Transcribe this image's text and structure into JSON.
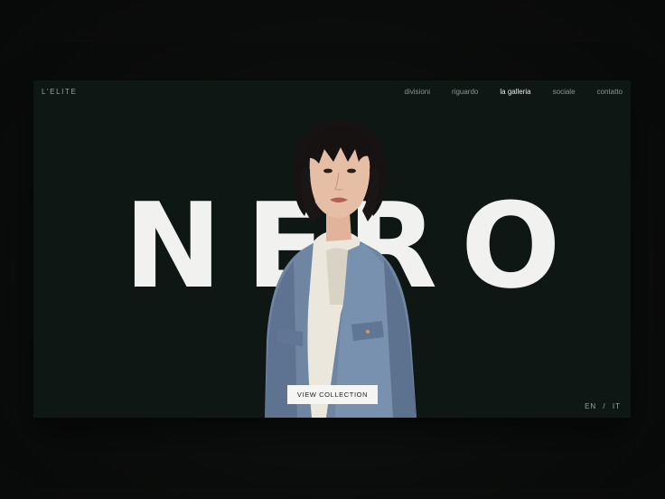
{
  "brand": "L'ELITE",
  "nav": {
    "items": [
      {
        "label": "divisioni"
      },
      {
        "label": "riguardo"
      },
      {
        "label": "la galleria",
        "active": true
      },
      {
        "label": "sociale"
      },
      {
        "label": "contatto"
      }
    ]
  },
  "hero": {
    "letters": [
      "N",
      "E",
      "R",
      "O"
    ]
  },
  "cta": {
    "label": "VIEW COLLECTION"
  },
  "lang": {
    "en": "EN",
    "sep": "/",
    "it": "IT"
  },
  "colors": {
    "background": "#0f1714",
    "hero_text": "#f1f1f0",
    "nav_active": "#e8ecea",
    "nav_inactive": "#8d9591",
    "button_bg": "#f5f5f3"
  }
}
